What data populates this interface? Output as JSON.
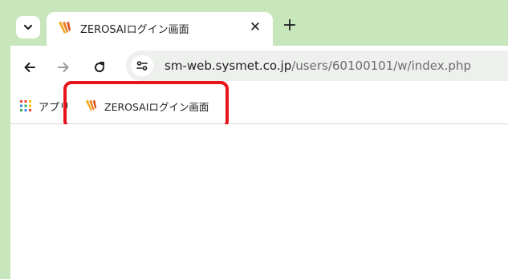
{
  "tab": {
    "title": "ZEROSAIログイン画面",
    "close_glyph": "✕",
    "favicon": "zerosai-favicon"
  },
  "tabstrip": {
    "new_tab_glyph": "+",
    "search_tabs_icon": "chevron-down-icon"
  },
  "toolbar": {
    "url_host": "sm-web.sysmet.co.jp",
    "url_path": "/users/60100101/w/index.php"
  },
  "bookmarks": {
    "apps_label": "アプリ",
    "item_label": "ZEROSAIログイン画面"
  },
  "colors": {
    "frame": "#c7e6bb",
    "highlight": "#e8141c",
    "omnibox": "#eef0ee"
  }
}
